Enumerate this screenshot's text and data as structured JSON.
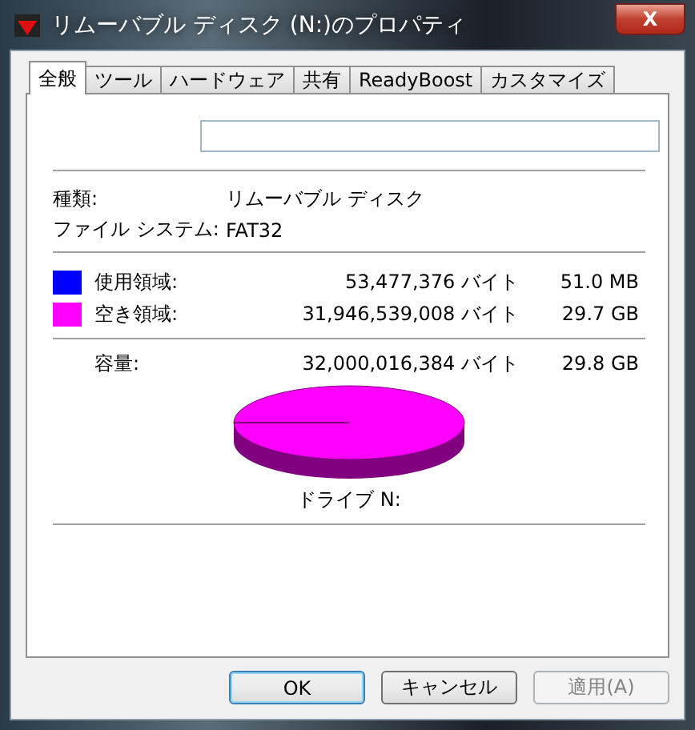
{
  "window": {
    "title": "リムーバブル ディスク (N:)のプロパティ",
    "close": "X"
  },
  "tabs": [
    {
      "label": "全般",
      "selected": true
    },
    {
      "label": "ツール",
      "selected": false
    },
    {
      "label": "ハードウェア",
      "selected": false
    },
    {
      "label": "共有",
      "selected": false
    },
    {
      "label": "ReadyBoost",
      "selected": false
    },
    {
      "label": "カスタマイズ",
      "selected": false
    }
  ],
  "info": [
    {
      "label": "種類:",
      "value": "リムーバブル ディスク"
    },
    {
      "label": "ファイル システム:",
      "value": "FAT32"
    }
  ],
  "space": [
    {
      "label": "使用領域:",
      "bytes": "53,477,376 バイト",
      "size": "51.0 MB",
      "color": "#0000ff"
    },
    {
      "label": "空き領域:",
      "bytes": "31,946,539,008 バイト",
      "size": "29.7 GB",
      "color": "#ff00ff"
    }
  ],
  "capacity": {
    "label": "容量:",
    "bytes": "32,000,016,384 バイト",
    "size": "29.8 GB"
  },
  "drive_label": "ドライブ N:",
  "buttons": [
    {
      "label": "OK",
      "default": true,
      "disabled": false
    },
    {
      "label": "キャンセル",
      "default": false,
      "disabled": false
    },
    {
      "label": "適用(A)",
      "default": false,
      "disabled": true
    }
  ]
}
